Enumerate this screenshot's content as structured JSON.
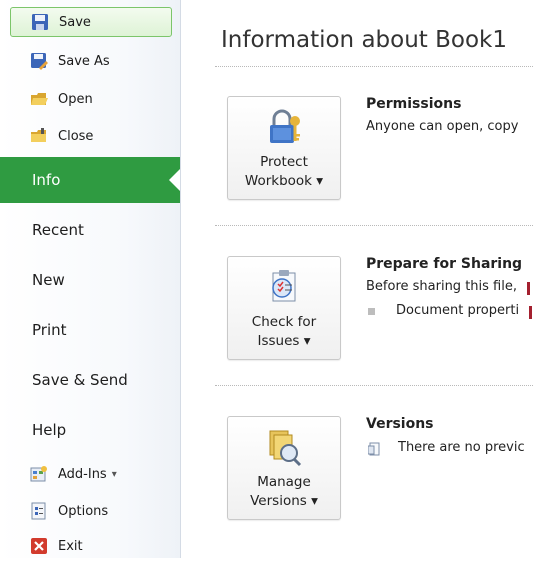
{
  "sidebar": {
    "commands_top": [
      {
        "label": "Save",
        "icon": "save-icon"
      },
      {
        "label": "Save As",
        "icon": "save-as-icon"
      },
      {
        "label": "Open",
        "icon": "open-folder-icon"
      },
      {
        "label": "Close",
        "icon": "close-folder-icon"
      }
    ],
    "tabs": [
      {
        "label": "Info",
        "selected": true
      },
      {
        "label": "Recent"
      },
      {
        "label": "New"
      },
      {
        "label": "Print"
      },
      {
        "label": "Save & Send"
      },
      {
        "label": "Help"
      }
    ],
    "commands_bottom": [
      {
        "label": "Add-Ins",
        "icon": "add-ins-icon",
        "has_dropdown": "▾"
      },
      {
        "label": "Options",
        "icon": "options-icon"
      },
      {
        "label": "Exit",
        "icon": "exit-icon"
      }
    ],
    "accent_color": "#2f9b41"
  },
  "main": {
    "title": "Information about Book1",
    "sections": [
      {
        "button_label": "Protect\nWorkbook ▾",
        "button_icon": "lock-keys-icon",
        "heading": "Permissions",
        "text": "Anyone can open, copy"
      },
      {
        "button_label": "Check for\nIssues ▾",
        "button_icon": "checklist-icon",
        "heading": "Prepare for Sharing",
        "text": "Before sharing this file,",
        "bullet_text": "Document properti"
      },
      {
        "button_label": "Manage\nVersions ▾",
        "button_icon": "versions-icon",
        "heading": "Versions",
        "text": "There are no previc"
      }
    ]
  }
}
